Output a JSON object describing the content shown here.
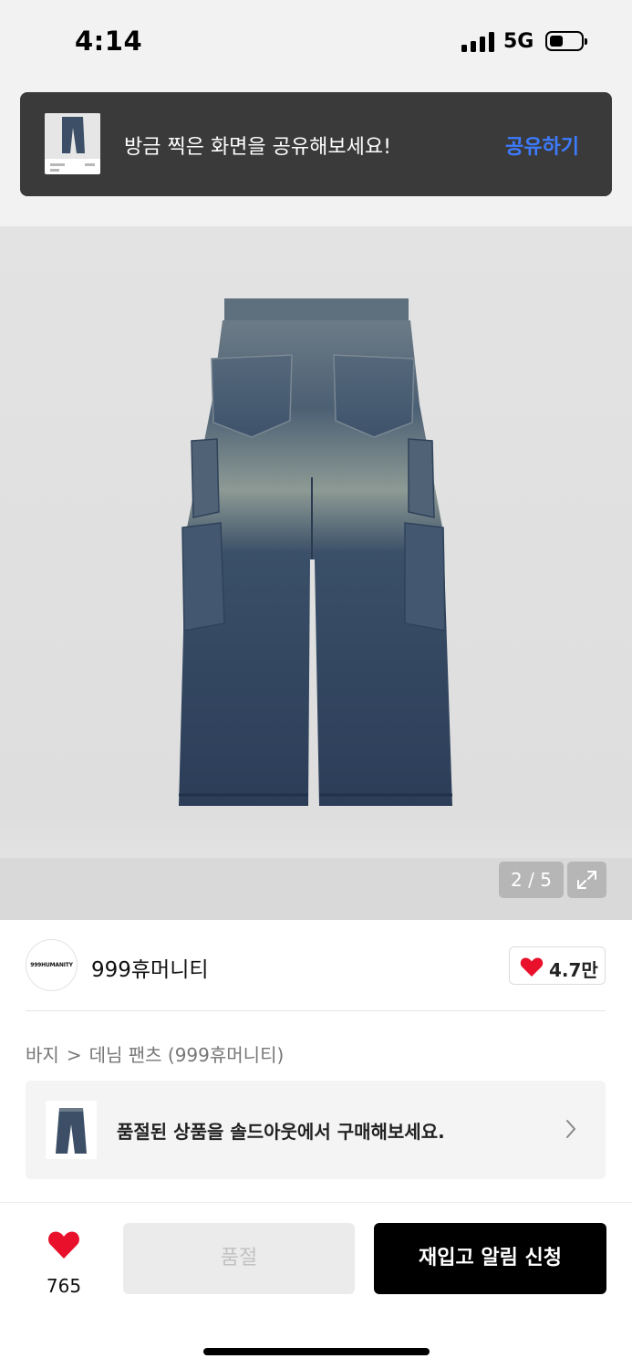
{
  "status_bar": {
    "time": "4:14",
    "network": "5G"
  },
  "share_toast": {
    "message": "방금 찍은 화면을 공유해보세요!",
    "action_label": "공유하기",
    "action_color": "#3d7bff"
  },
  "product_image": {
    "page_indicator": "2 / 5",
    "current_page": 2,
    "total_pages": 5,
    "expand_icon": "expand-icon"
  },
  "brand": {
    "logo_text": "999HUMANITY",
    "name": "999휴머니티",
    "like_count": "4.7만",
    "like_icon": "heart-icon",
    "heart_color": "#e8102a"
  },
  "breadcrumb": {
    "category": "바지",
    "separator": ">",
    "subcategory": "데님 팬츠 (999휴머니티)"
  },
  "soldout_banner": {
    "text": "품절된 상품을 솔드아웃에서 구매해보세요.",
    "chevron_icon": "chevron-right-icon"
  },
  "bottom_bar": {
    "wish_count": "765",
    "soldout_label": "품절",
    "restock_label": "재입고 알림 신청"
  }
}
